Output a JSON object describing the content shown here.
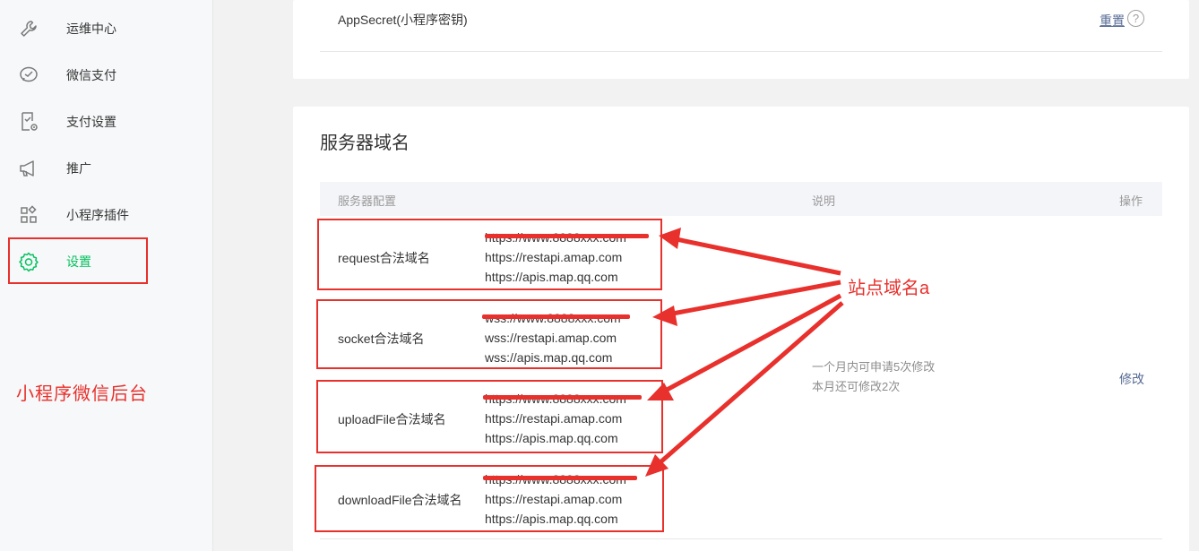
{
  "sidebar": {
    "items": [
      {
        "label": "运维中心",
        "icon": "wrench-icon"
      },
      {
        "label": "微信支付",
        "icon": "wechat-pay-icon"
      },
      {
        "label": "支付设置",
        "icon": "pay-settings-icon"
      },
      {
        "label": "推广",
        "icon": "megaphone-icon"
      },
      {
        "label": "小程序插件",
        "icon": "plugin-grid-icon"
      },
      {
        "label": "设置",
        "icon": "gear-icon",
        "active": true
      }
    ],
    "note": "小程序微信后台"
  },
  "app_secret": {
    "label": "AppSecret(小程序密钥)",
    "reset_label": "重置",
    "help_glyph": "?"
  },
  "server_domain": {
    "title": "服务器域名",
    "columns": [
      "服务器配置",
      "说明",
      "操作"
    ],
    "rows": [
      {
        "label": "request合法域名",
        "urls": [
          "https://www.8888xxx.com",
          "https://restapi.amap.com",
          "https://apis.map.qq.com"
        ]
      },
      {
        "label": "socket合法域名",
        "urls": [
          "wss://www.8888xxx.com",
          "wss://restapi.amap.com",
          "wss://apis.map.qq.com"
        ]
      },
      {
        "label": "uploadFile合法域名",
        "urls": [
          "https://www.8888xxx.com",
          "https://restapi.amap.com",
          "https://apis.map.qq.com"
        ]
      },
      {
        "label": "downloadFile合法域名",
        "urls": [
          "https://www.8888xxx.com",
          "https://restapi.amap.com",
          "https://apis.map.qq.com"
        ]
      }
    ],
    "description": [
      "一个月内可申请5次修改",
      "本月还可修改2次"
    ],
    "action_label": "修改"
  },
  "annotation": {
    "label": "站点域名a",
    "color": "#e8302c"
  },
  "colors": {
    "accent_green": "#07c160",
    "link_blue": "#576b95",
    "annotation_red": "#e8302c"
  }
}
